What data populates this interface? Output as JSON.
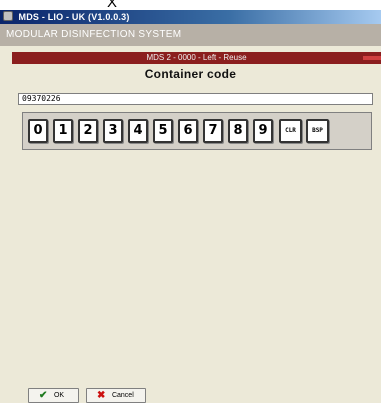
{
  "top_marker": "X",
  "window": {
    "title": "MDS - LIO - UK  (V1.0.0.3)",
    "system_bar": "MODULAR DISINFECTION SYSTEM",
    "status_bar": "MDS 2 - 0000 - Left - Reuse",
    "status_color": "#8b1e1e"
  },
  "form": {
    "heading": "Container code",
    "code_value": "09370226"
  },
  "keypad": {
    "keys": [
      "0",
      "1",
      "2",
      "3",
      "4",
      "5",
      "6",
      "7",
      "8",
      "9",
      "CLR",
      "BSP"
    ]
  },
  "footer": {
    "ok_label": "OK",
    "cancel_label": "Cancel",
    "ok_icon": "check-icon",
    "cancel_icon": "x-icon"
  }
}
